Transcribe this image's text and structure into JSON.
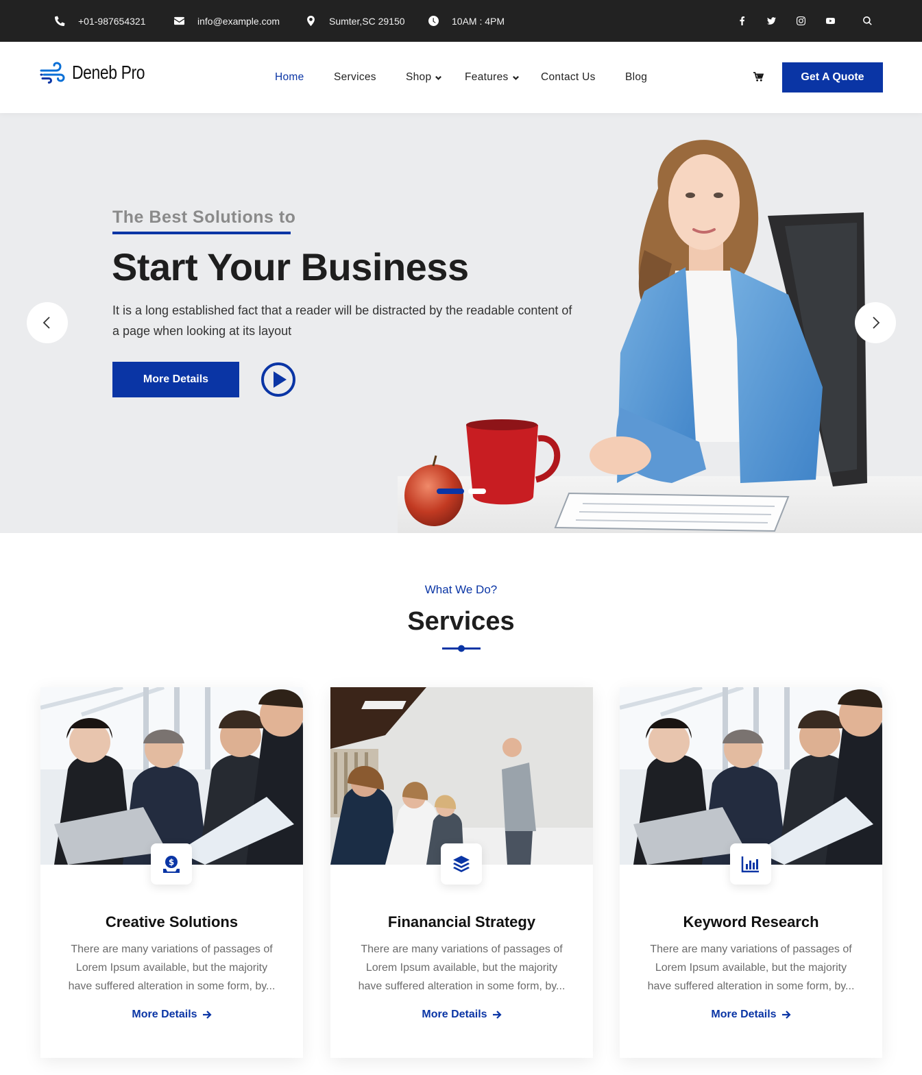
{
  "topbar": {
    "phone": "+01-987654321",
    "email": "info@example.com",
    "location": "Sumter,SC 29150",
    "hours": "10AM : 4PM",
    "social_icons": [
      "facebook-icon",
      "twitter-icon",
      "instagram-icon",
      "youtube-icon",
      "search-icon"
    ]
  },
  "header": {
    "logo_text": "Deneb Pro",
    "nav": [
      {
        "label": "Home",
        "active": true
      },
      {
        "label": "Services"
      },
      {
        "label": "Shop",
        "dropdown": true
      },
      {
        "label": "Features",
        "dropdown": true
      },
      {
        "label": "Contact Us"
      },
      {
        "label": "Blog"
      }
    ],
    "quote_button": "Get A Quote"
  },
  "hero": {
    "eyebrow": "The Best Solutions to",
    "title": "Start Your Business",
    "text": "It is a long established fact that a reader will be distracted by the readable content of a page when looking at its layout",
    "button": "More Details",
    "slides_total": 2,
    "active_slide": 1
  },
  "services": {
    "eyebrow": "What We Do?",
    "title": "Services",
    "cards": [
      {
        "title": "Creative Solutions",
        "icon": "money-bag-icon",
        "text": "There are many variations of passages of Lorem Ipsum available, but the majority have suffered alteration in some form, by...",
        "link": "More Details"
      },
      {
        "title": "Finanancial Strategy",
        "icon": "layers-icon",
        "text": "There are many variations of passages of Lorem Ipsum available, but the majority have suffered alteration in some form, by...",
        "link": "More Details"
      },
      {
        "title": "Keyword Research",
        "icon": "bar-chart-icon",
        "text": "There are many variations of passages of Lorem Ipsum available, but the majority have suffered alteration in some form, by...",
        "link": "More Details"
      }
    ]
  },
  "colors": {
    "brand": "#0a35a5",
    "topbar_bg": "#222222",
    "hero_bg": "#ebecee"
  }
}
